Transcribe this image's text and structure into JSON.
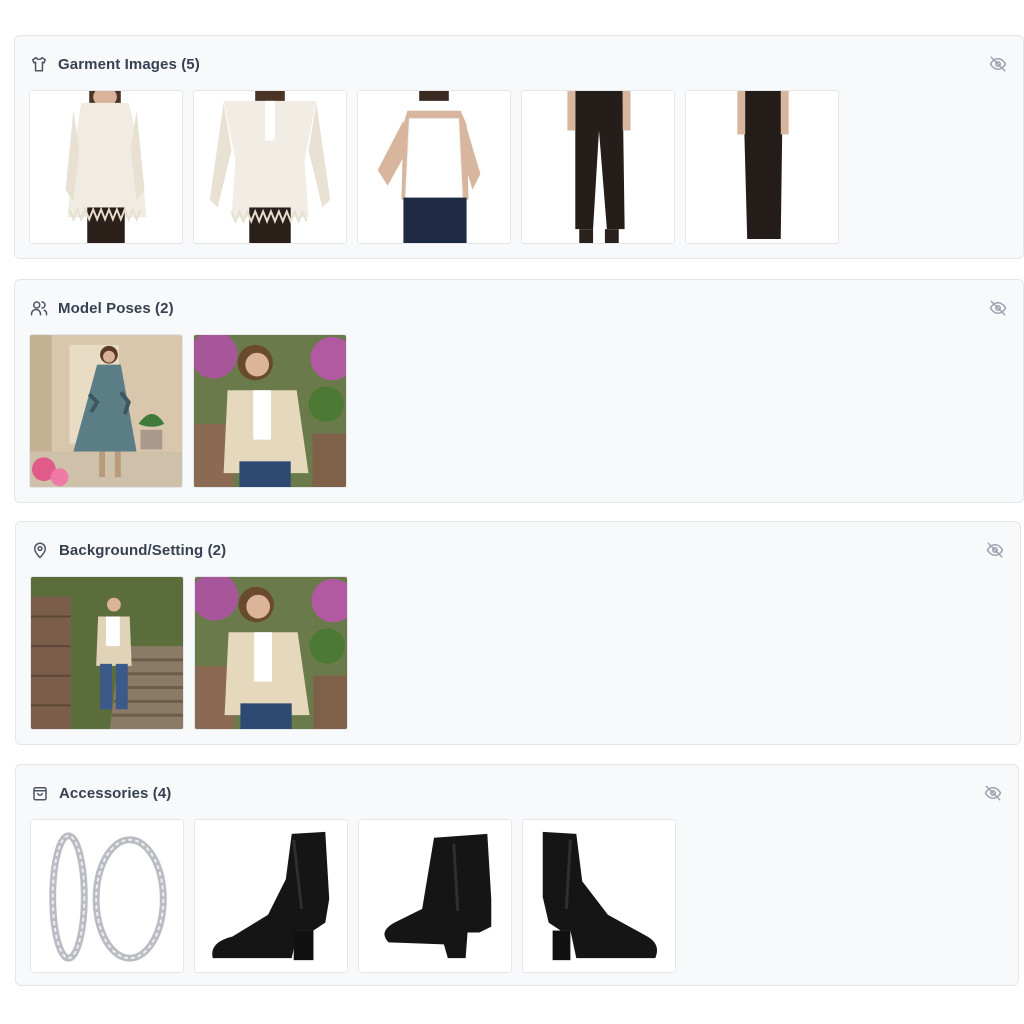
{
  "sections": [
    {
      "id": "garments",
      "icon": "shirt-icon",
      "title": "Garment Images (5)",
      "items": [
        "cream-fringe-cardigan",
        "cream-fringe-cardigan-closeup",
        "white-camisole",
        "black-wide-leg-pants",
        "black-wide-leg-pants-side"
      ]
    },
    {
      "id": "poses",
      "icon": "users-icon",
      "title": "Model Poses (2)",
      "items": [
        "floral-maxi-dress-pose",
        "beige-jacket-garden-pose"
      ]
    },
    {
      "id": "background",
      "icon": "map-pin-icon",
      "title": "Background/Setting (2)",
      "items": [
        "stone-stairs-setting",
        "garden-flowers-setting"
      ]
    },
    {
      "id": "accessories",
      "icon": "shopping-bag-icon",
      "title": "Accessories (4)",
      "items": [
        "silver-hoop-earrings",
        "black-ankle-boot-side",
        "black-ankle-boot-angle",
        "black-ankle-boot-profile"
      ]
    }
  ],
  "colors": {
    "panel_bg": "#f8f9fb",
    "border": "#e3e6ea",
    "title": "#374151",
    "icon": "#4b5563",
    "hide_icon": "#9ca3af"
  }
}
